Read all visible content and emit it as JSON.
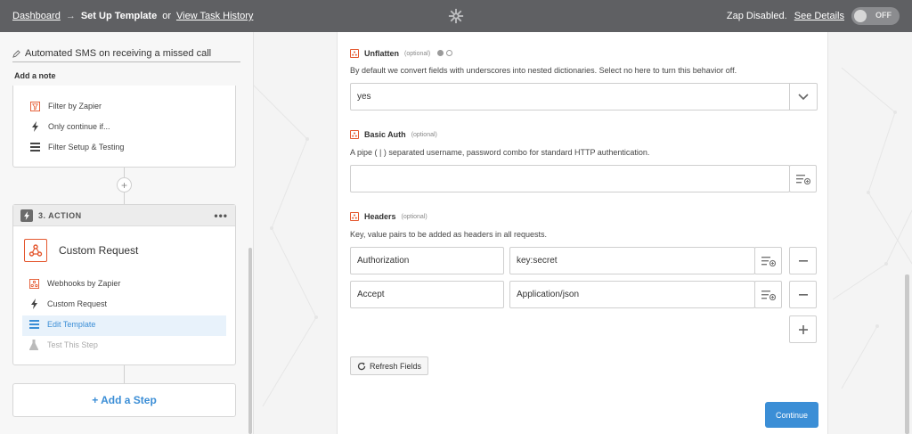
{
  "topbar": {
    "dashboard": "Dashboard",
    "arrow": "→",
    "title": "Set Up Template",
    "or": "or",
    "history": "View Task History",
    "status": "Zap Disabled.",
    "see_details": "See Details",
    "toggle": "OFF"
  },
  "sidebar": {
    "zap_name": "Automated SMS on receiving a missed call",
    "add_note": "Add a note",
    "step2": {
      "items": [
        "Filter by Zapier",
        "Only continue if...",
        "Filter Setup & Testing"
      ]
    },
    "step3": {
      "header": "3. ACTION",
      "menu": "•••",
      "app_title": "Custom Request",
      "items": [
        "Webhooks by Zapier",
        "Custom Request",
        "Edit Template",
        "Test This Step"
      ]
    },
    "add_step": "+ Add a Step"
  },
  "form": {
    "unflatten": {
      "label": "Unflatten",
      "optional": "(optional)",
      "description": "By default we convert fields with underscores into nested dictionaries. Select no here to turn this behavior off.",
      "value": "yes"
    },
    "basic_auth": {
      "label": "Basic Auth",
      "optional": "(optional)",
      "description": "A pipe ( | ) separated username, password combo for standard HTTP authentication.",
      "value": ""
    },
    "headers": {
      "label": "Headers",
      "optional": "(optional)",
      "description": "Key, value pairs to be added as headers in all requests.",
      "rows": [
        {
          "key": "Authorization",
          "value": "key:secret"
        },
        {
          "key": "Accept",
          "value": "Application/json"
        }
      ]
    },
    "refresh": "Refresh Fields",
    "continue": "Continue"
  },
  "colors": {
    "topbar": "#5f6063",
    "accent": "#3b8ed6",
    "zapier_orange": "#e4572e"
  }
}
